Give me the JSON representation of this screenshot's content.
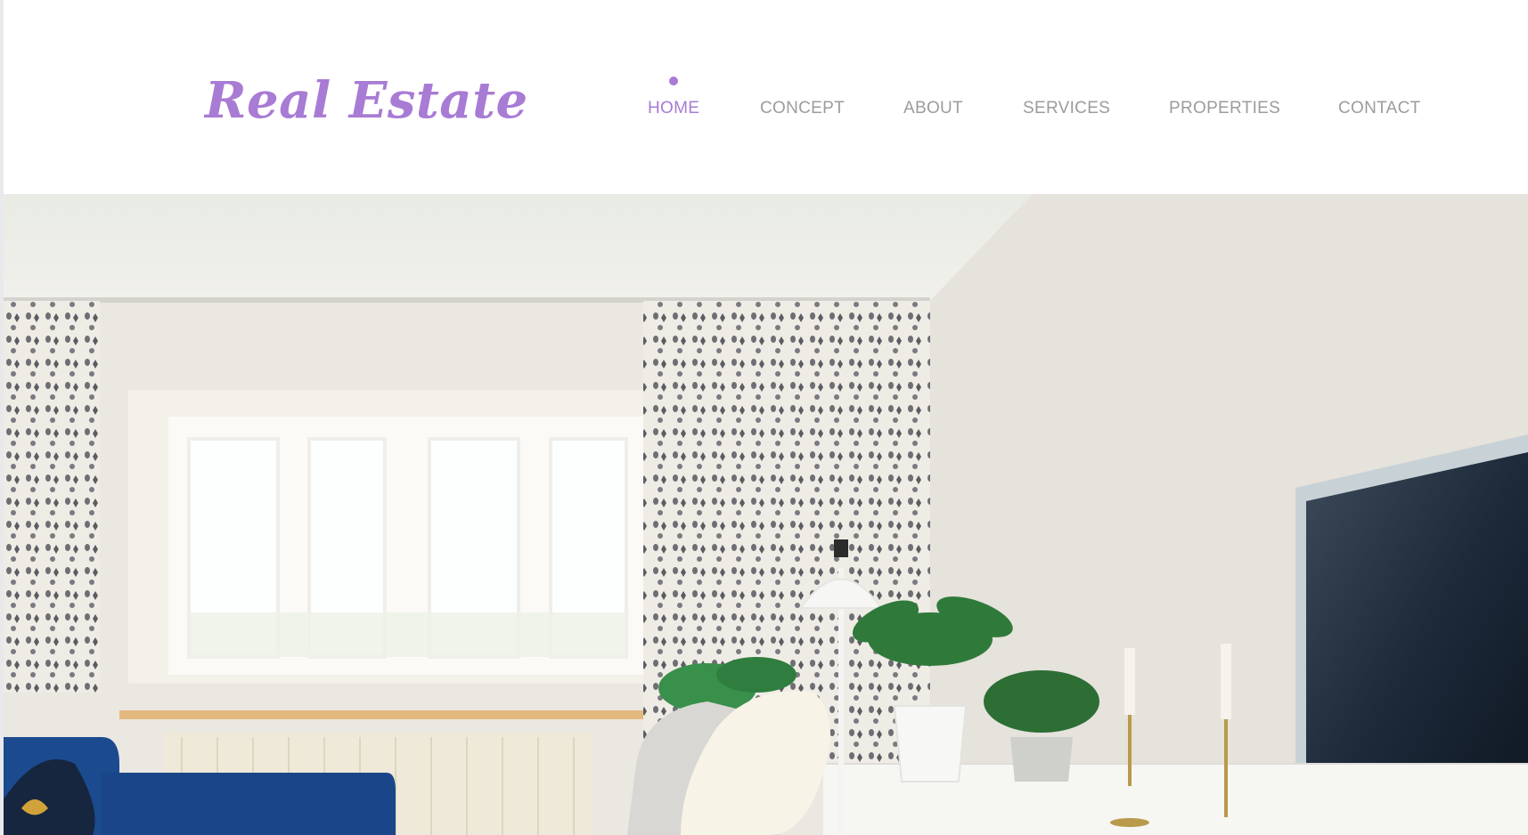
{
  "brand": {
    "logo_text": "Real Estate",
    "accent_color": "#a87bd4"
  },
  "nav": {
    "active": "HOME",
    "items": [
      {
        "label": "HOME"
      },
      {
        "label": "CONCEPT"
      },
      {
        "label": "ABOUT"
      },
      {
        "label": "SERVICES"
      },
      {
        "label": "PROPERTIES"
      },
      {
        "label": "CONTACT"
      }
    ],
    "inactive_color": "#9c9c9c"
  },
  "hero": {
    "image": "living-room-photo"
  }
}
